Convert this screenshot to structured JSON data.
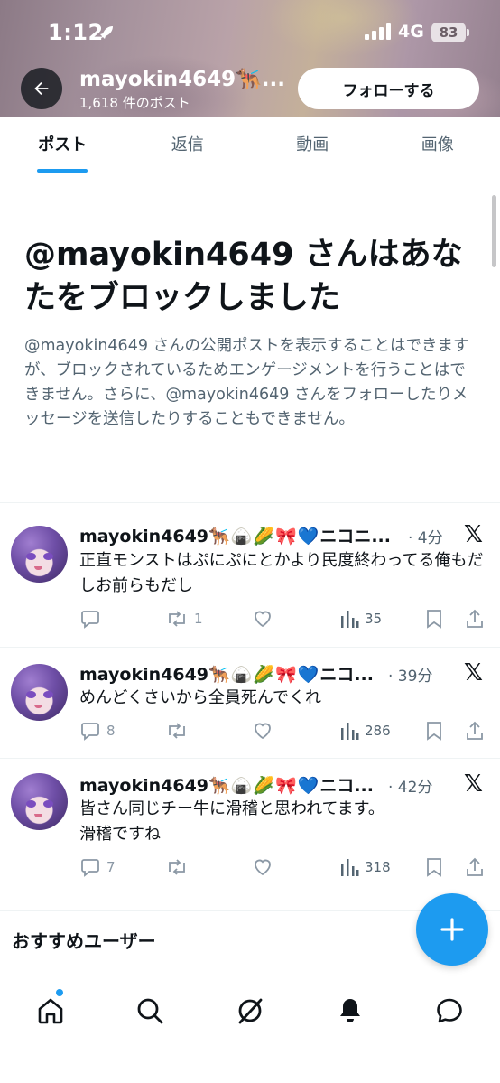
{
  "status_bar": {
    "time": "1:12",
    "network": "4G",
    "battery": "83"
  },
  "header": {
    "name": "mayokin4649🐕‍🦺...",
    "post_count": "1,618 件のポスト",
    "follow_label": "フォローする"
  },
  "tabs": [
    {
      "label": "ポスト",
      "active": true
    },
    {
      "label": "返信",
      "active": false
    },
    {
      "label": "動画",
      "active": false
    },
    {
      "label": "画像",
      "active": false
    }
  ],
  "blocked": {
    "title": "@mayokin4649 さんはあなたをブロックしました",
    "description": "@mayokin4649 さんの公開ポストを表示することはできますが、ブロックされているためエンゲージメントを行うことはできません。さらに、@mayokin4649 さんをフォローしたりメッセージを送信したりすることもできません。"
  },
  "posts": [
    {
      "name": "mayokin4649",
      "emojis": "🐕‍🦺🍙🌽🎀💙",
      "name_suffix": "ニコニ...",
      "time": "· 4分",
      "text": "正直モンストはぷにぷにとかより民度終わってる俺もだしお前らもだし",
      "replies": "",
      "reposts": "1",
      "views": "35"
    },
    {
      "name": "mayokin4649",
      "emojis": "🐕‍🦺🍙🌽🎀💙",
      "name_suffix": "ニコ...",
      "time": "· 39分",
      "text": "めんどくさいから全員死んでくれ",
      "replies": "8",
      "reposts": "",
      "views": "286"
    },
    {
      "name": "mayokin4649",
      "emojis": "🐕‍🦺🍙🌽🎀💙",
      "name_suffix": "ニコ...",
      "time": "· 42分",
      "text": "皆さん同じチー牛に滑稽と思われてます。\n滑稽ですね",
      "replies": "7",
      "reposts": "",
      "views": "318"
    }
  ],
  "recommend": {
    "title": "おすすめユーザー"
  },
  "icons": {
    "back": "arrow-left-icon",
    "reply": "speech-bubble-icon",
    "repost": "repost-arrows-icon",
    "like": "heart-icon",
    "views": "bar-chart-icon",
    "bookmark": "bookmark-icon",
    "share": "share-icon",
    "compose": "plus-icon",
    "home": "home-icon",
    "search": "search-icon",
    "grok": "grok-slash-icon",
    "notifications": "bell-icon",
    "messages": "chat-bubble-icon"
  },
  "colors": {
    "accent": "#1d9bf0",
    "text": "#0f1419",
    "muted": "#536471"
  }
}
